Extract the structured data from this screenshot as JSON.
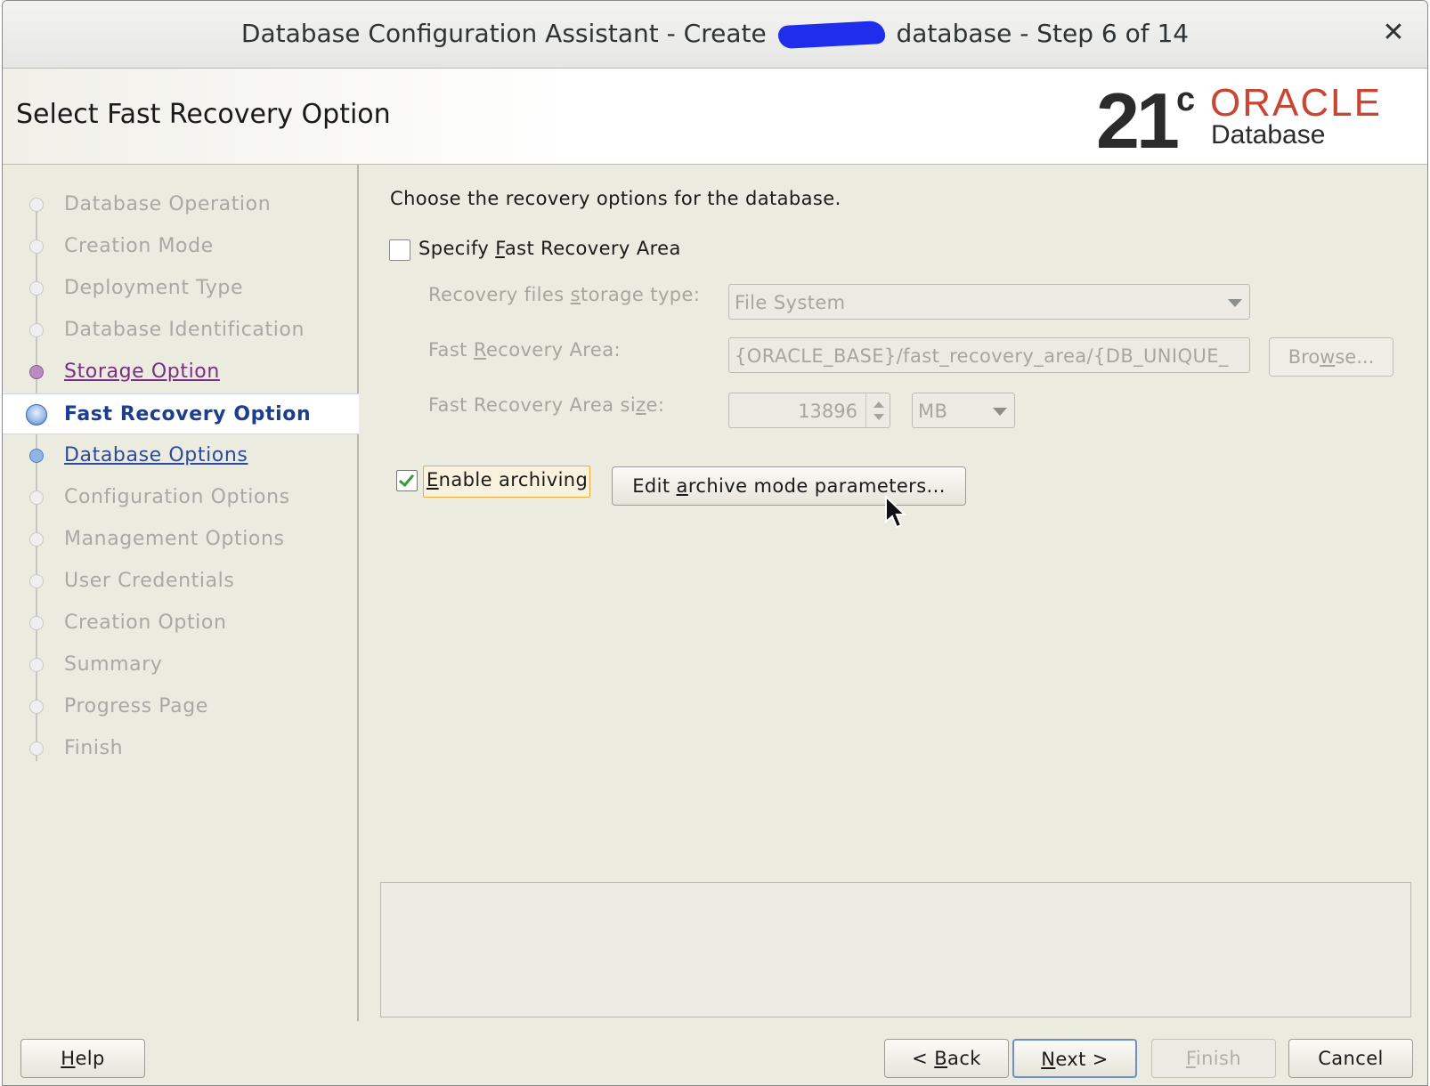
{
  "window": {
    "title_prefix": "Database Configuration Assistant - Create",
    "title_suffix": "database - Step 6 of 14",
    "close_glyph": "✕"
  },
  "header": {
    "page_title": "Select Fast Recovery Option",
    "logo_number": "21",
    "logo_superscript": "c",
    "logo_brand": "ORACLE",
    "logo_product": "Database",
    "brand_color": "#c74634"
  },
  "nav": {
    "items": [
      {
        "label": "Database Operation",
        "state": "disabled"
      },
      {
        "label": "Creation Mode",
        "state": "disabled"
      },
      {
        "label": "Deployment Type",
        "state": "disabled"
      },
      {
        "label": "Database Identification",
        "state": "disabled"
      },
      {
        "label": "Storage Option",
        "state": "visited"
      },
      {
        "label": "Fast Recovery Option",
        "state": "current"
      },
      {
        "label": "Database Options",
        "state": "next"
      },
      {
        "label": "Configuration Options",
        "state": "disabled"
      },
      {
        "label": "Management Options",
        "state": "disabled"
      },
      {
        "label": "User Credentials",
        "state": "disabled"
      },
      {
        "label": "Creation Option",
        "state": "disabled"
      },
      {
        "label": "Summary",
        "state": "disabled"
      },
      {
        "label": "Progress Page",
        "state": "disabled"
      },
      {
        "label": "Finish",
        "state": "disabled"
      }
    ]
  },
  "content": {
    "intro": "Choose the recovery options for the database.",
    "specify_fra": {
      "label_pre": "Specify ",
      "label_mn": "F",
      "label_post": "ast Recovery Area",
      "checked": false
    },
    "storage_type": {
      "label_pre": "Recovery files ",
      "label_mn": "s",
      "label_post": "torage type:",
      "value": "File System"
    },
    "fra": {
      "label_pre": "Fast ",
      "label_mn": "R",
      "label_post": "ecovery Area:",
      "value": "{ORACLE_BASE}/fast_recovery_area/{DB_UNIQUE_",
      "browse_pre": "Bro",
      "browse_mn": "w",
      "browse_post": "se..."
    },
    "fra_size": {
      "label_pre": "Fast Recovery Area si",
      "label_mn": "z",
      "label_post": "e:",
      "value": "13896",
      "unit": "MB"
    },
    "archiving": {
      "label_mn": "E",
      "label_post": "nable archiving",
      "checked": true
    },
    "edit_button": {
      "pre": "Edit ",
      "mn": "a",
      "post": "rchive mode parameters..."
    }
  },
  "footer": {
    "help": {
      "mn": "H",
      "post": "elp"
    },
    "back": {
      "pre": "< ",
      "mn": "B",
      "post": "ack"
    },
    "next": {
      "mn": "N",
      "post": "ext >"
    },
    "finish": {
      "mn": "F",
      "post": "inish"
    },
    "cancel": "Cancel"
  }
}
